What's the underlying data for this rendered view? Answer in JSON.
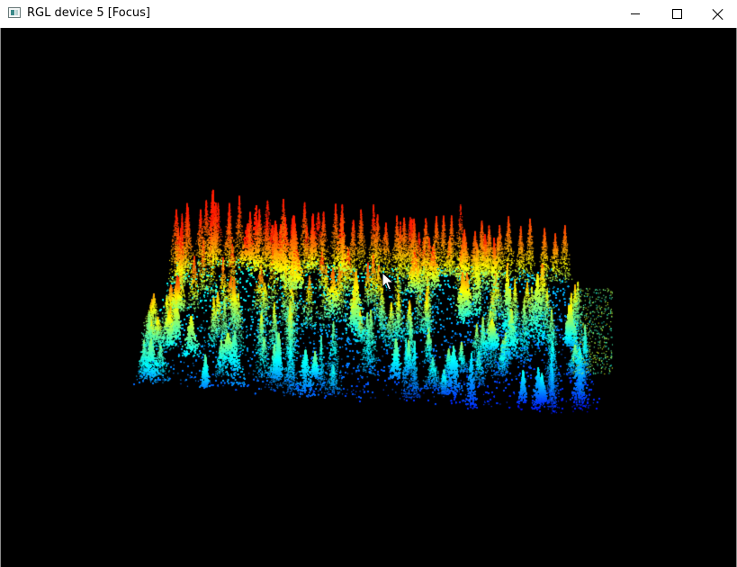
{
  "window": {
    "title": "RGL device 5 [Focus]",
    "app_icon": "rgl-window-icon",
    "controls": {
      "minimize_icon": "minimize-icon",
      "maximize_icon": "maximize-icon",
      "close_icon": "close-icon"
    }
  },
  "viewport": {
    "background": "#000000",
    "content": "point-cloud-forest",
    "colormap": [
      "#0000ff",
      "#0080ff",
      "#00ffff",
      "#80ff80",
      "#ffff00",
      "#ff8000",
      "#ff2000"
    ]
  },
  "cursor": {
    "icon": "mouse-pointer-icon"
  }
}
